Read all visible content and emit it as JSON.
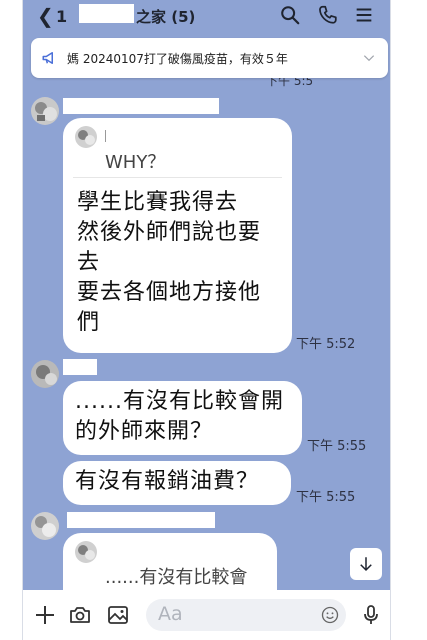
{
  "header": {
    "back_count": "1",
    "title": "之家 (5)"
  },
  "announcement": {
    "text": "媽 20240107打了破傷風疫苗，有效５年"
  },
  "partial_time": "下午 5:5",
  "messages": [
    {
      "quote": "WHY？",
      "text": "學生比賽我得去\n然後外師們說也要\n去\n要去各個地方接他\n們",
      "time": "下午 5:52"
    },
    {
      "text": "......有沒有比較會開\n的外師來開？",
      "time": "下午 5:55"
    },
    {
      "text": "有沒有報銷油費？",
      "time": "下午 5:55"
    },
    {
      "quote": "......有沒有比較會"
    }
  ],
  "input": {
    "placeholder": "Aa"
  },
  "colors": {
    "chat_background": "#8ea3d3",
    "bubble": "#ffffff"
  },
  "icons": [
    "back-chevron-icon",
    "search-icon",
    "phone-icon",
    "menu-icon",
    "megaphone-icon",
    "chevron-down-icon",
    "arrow-down-icon",
    "plus-icon",
    "camera-icon",
    "image-icon",
    "emoji-icon",
    "microphone-icon"
  ]
}
